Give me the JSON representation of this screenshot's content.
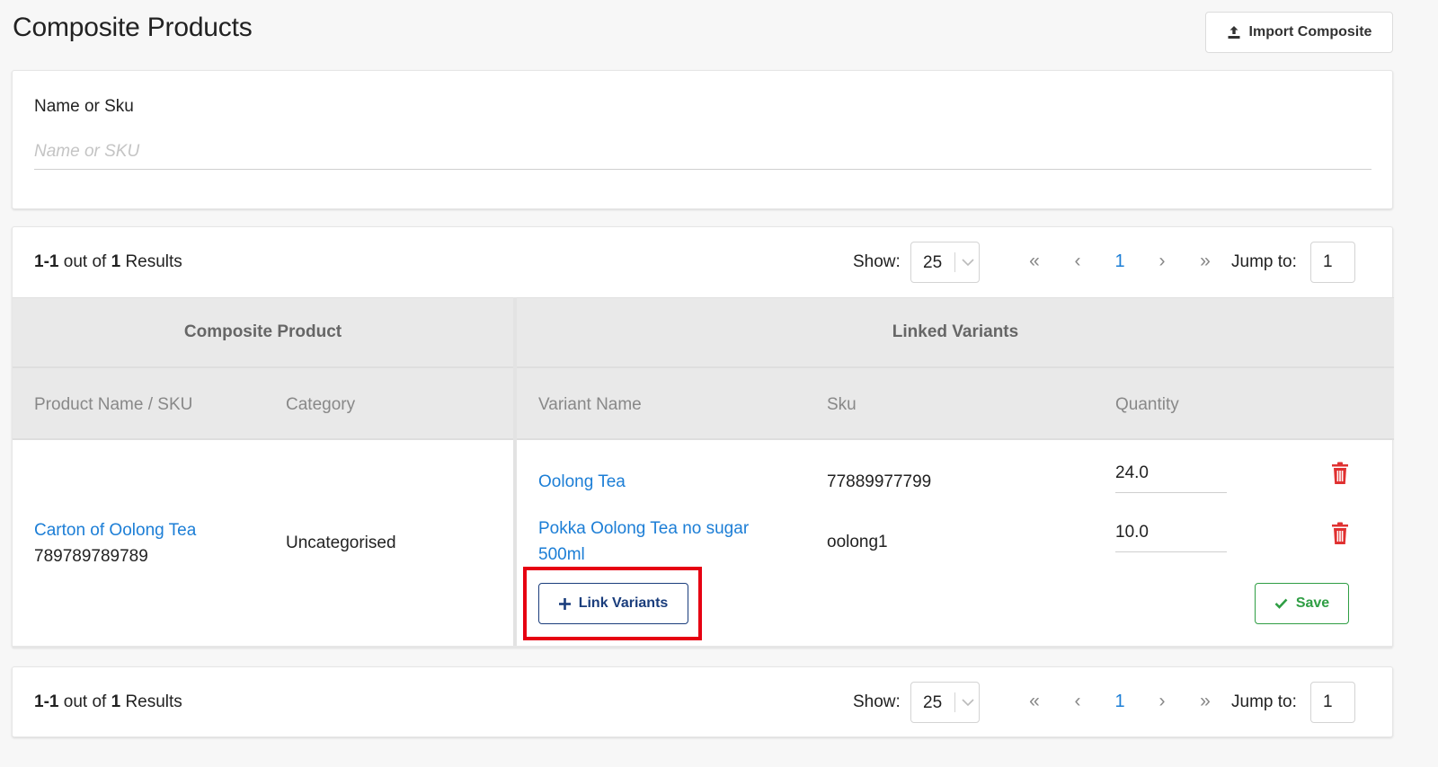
{
  "header": {
    "title": "Composite Products",
    "import_label": "Import Composite"
  },
  "filter": {
    "label": "Name or Sku",
    "placeholder": "Name or SKU",
    "value": ""
  },
  "pagination": {
    "range": "1-1",
    "out_of": "out of",
    "total": "1",
    "results_word": "Results",
    "show_label": "Show:",
    "page_size": "25",
    "first": "«",
    "prev": "‹",
    "current_page": "1",
    "next": "›",
    "last": "»",
    "jump_label": "Jump to:",
    "jump_value": "1"
  },
  "table": {
    "group_headers": {
      "composite": "Composite Product",
      "linked": "Linked Variants"
    },
    "columns": {
      "product": "Product Name / SKU",
      "category": "Category",
      "variant": "Variant Name",
      "sku": "Sku",
      "quantity": "Quantity"
    },
    "row": {
      "product_name": "Carton of Oolong Tea",
      "product_sku": "789789789789",
      "category": "Uncategorised",
      "variants": [
        {
          "name": "Oolong Tea",
          "sku": "77889977799",
          "quantity": "24.0"
        },
        {
          "name_line1": "Pokka Oolong Tea no sugar",
          "name_line2": "500ml",
          "sku": "oolong1",
          "quantity": "10.0"
        }
      ],
      "link_variants_label": "Link Variants",
      "save_label": "Save"
    }
  },
  "colors": {
    "link": "#1c7ed6",
    "danger": "#e03131",
    "success": "#2f9e44",
    "primary_outline": "#1a3d7c",
    "highlight": "#e60012"
  }
}
